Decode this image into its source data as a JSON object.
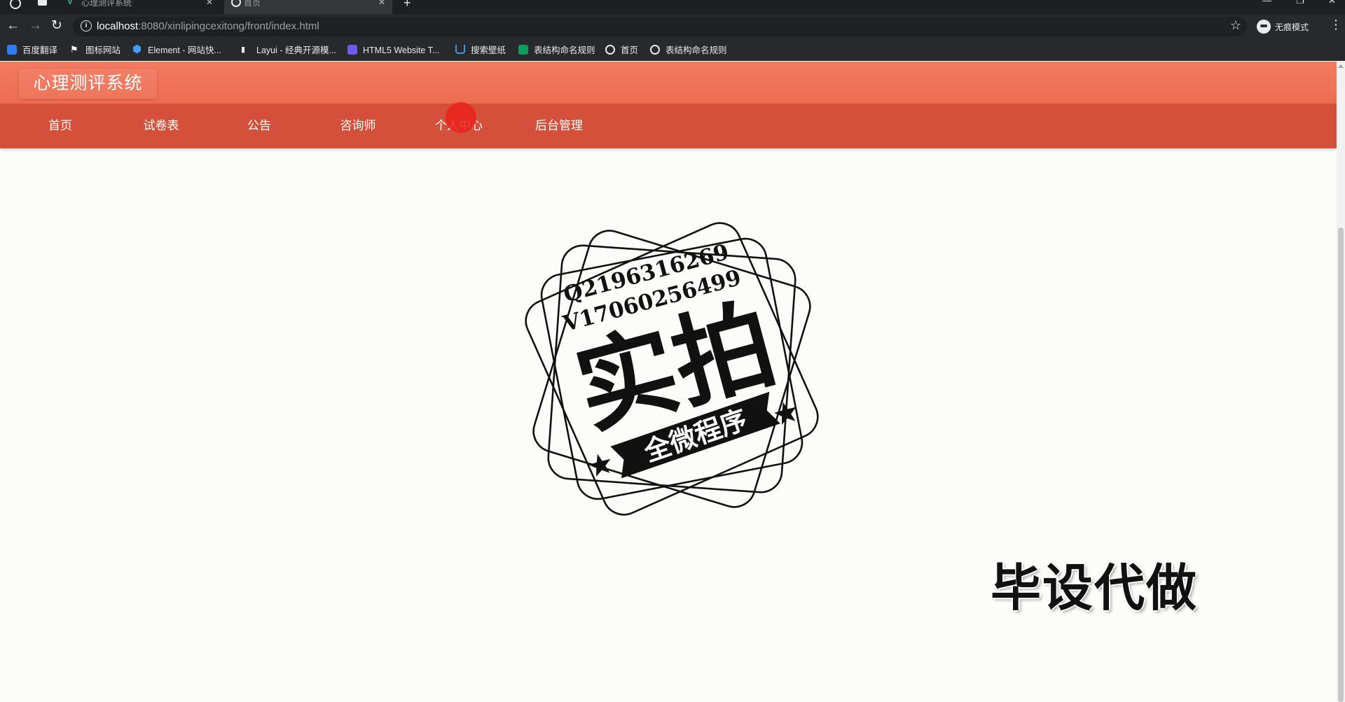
{
  "browser": {
    "tabs": [
      {
        "title": "心理测评系统",
        "icon": "vue-icon",
        "active": false
      },
      {
        "title": "首页",
        "icon": "globe-icon",
        "active": true
      }
    ],
    "url": {
      "host": "localhost",
      "rest": ":8080/xinlipingcexitong/front/index.html"
    },
    "profile_label": "无痕模式",
    "bookmarks": [
      {
        "label": "百度翻译",
        "icon": "translate-icon"
      },
      {
        "label": "图标网站",
        "icon": "flag-icon"
      },
      {
        "label": "Element - 网站快...",
        "icon": "element-icon"
      },
      {
        "label": "Layui - 经典开源模...",
        "icon": "layui-icon"
      },
      {
        "label": "HTML5 Website T...",
        "icon": "html5-icon"
      },
      {
        "label": "搜索壁纸",
        "icon": "unsplash-icon"
      },
      {
        "label": "表结构命名规则",
        "icon": "sheet-icon"
      },
      {
        "label": "首页",
        "icon": "globe-icon"
      },
      {
        "label": "表结构命名规则",
        "icon": "globe-icon"
      }
    ]
  },
  "site": {
    "title": "心理测评系统",
    "nav": [
      {
        "label": "首页"
      },
      {
        "label": "试卷表"
      },
      {
        "label": "公告"
      },
      {
        "label": "咨询师"
      },
      {
        "label": "个人中心"
      },
      {
        "label": "后台管理"
      }
    ]
  },
  "watermark": {
    "qq": "Q2196316269",
    "wx": "V17060256499",
    "main": "实拍",
    "ribbon": "全微程序",
    "corner": "毕设代做"
  },
  "theme": {
    "header_color": "#ef7257",
    "nav_color": "#d5503a",
    "click_marker_color": "#e8211c",
    "browser_dark": "#28292c"
  }
}
